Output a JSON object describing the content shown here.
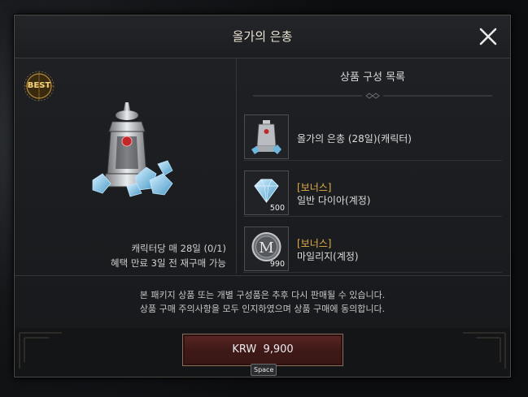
{
  "dialog": {
    "title": "올가의 은총",
    "close_icon": "close-icon",
    "best_badge": "BEST",
    "limit_line1": "캐릭터당 매 28일 (0/1)",
    "limit_line2": "혜택 만료 3일 전 재구매 가능"
  },
  "contents": {
    "heading": "상품 구성 목록",
    "items": [
      {
        "name": "올가의 은총 (28일)(캐릭터)",
        "bonus": "",
        "qty": "",
        "icon": "lantern-icon"
      },
      {
        "name": "일반 다이아(계정)",
        "bonus": "[보너스]",
        "qty": "500",
        "icon": "diamond-icon"
      },
      {
        "name": "마일리지(계정)",
        "bonus": "[보너스]",
        "qty": "990",
        "icon": "mileage-coin-icon"
      }
    ]
  },
  "notice": {
    "line1": "본 패키지 상품 또는 개별 구성품은 추후 다시 판매될 수 있습니다.",
    "line2": "상품 구매 주의사항을 모두 인지하였으며 상품 구매에 동의합니다."
  },
  "purchase": {
    "price_label": "KRW  9,900",
    "key_hint": "Space"
  },
  "colors": {
    "bonus": "#e3b047",
    "badge": "#f4d27a",
    "button": "#4a1f1e"
  }
}
